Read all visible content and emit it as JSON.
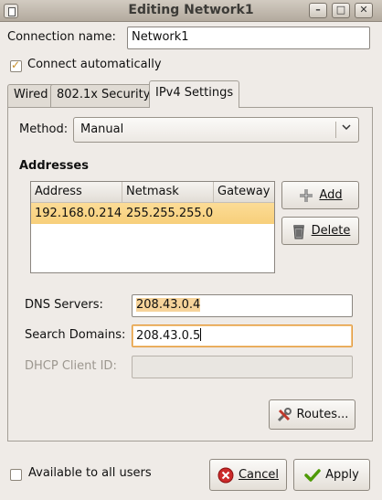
{
  "window": {
    "title": "Editing Network1"
  },
  "connection": {
    "name_label": "Connection name:",
    "name_value": "Network1",
    "auto_connect_label": "Connect automatically",
    "auto_connect_checked": true
  },
  "tabs": [
    {
      "label": "Wired"
    },
    {
      "label": "802.1x Security"
    },
    {
      "label": "IPv4 Settings"
    }
  ],
  "ipv4": {
    "method_label": "Method:",
    "method_value": "Manual",
    "addresses_heading": "Addresses",
    "columns": [
      "Address",
      "Netmask",
      "Gateway"
    ],
    "rows": [
      {
        "address": "192.168.0.214",
        "netmask": "255.255.255.0",
        "gateway": ""
      }
    ],
    "add_label": "Add",
    "delete_label": "Delete",
    "dns_label": "DNS Servers:",
    "dns_value": "208.43.0.4",
    "search_label": "Search Domains:",
    "search_value": "208.43.0.5",
    "dhcp_label": "DHCP Client ID:",
    "dhcp_value": "",
    "routes_label": "Routes..."
  },
  "footer": {
    "all_users_label": "Available to all users",
    "cancel_label": "Cancel",
    "apply_label": "Apply"
  },
  "icons": [
    "window-menu-icon",
    "minimize-icon",
    "maximize-icon",
    "close-icon",
    "add-icon",
    "trash-icon",
    "tools-icon",
    "cancel-icon",
    "checkmark-icon",
    "chevron-down-icon"
  ],
  "colors": {
    "selection": "#f7cf7a",
    "focus_border": "#e49a3b"
  }
}
